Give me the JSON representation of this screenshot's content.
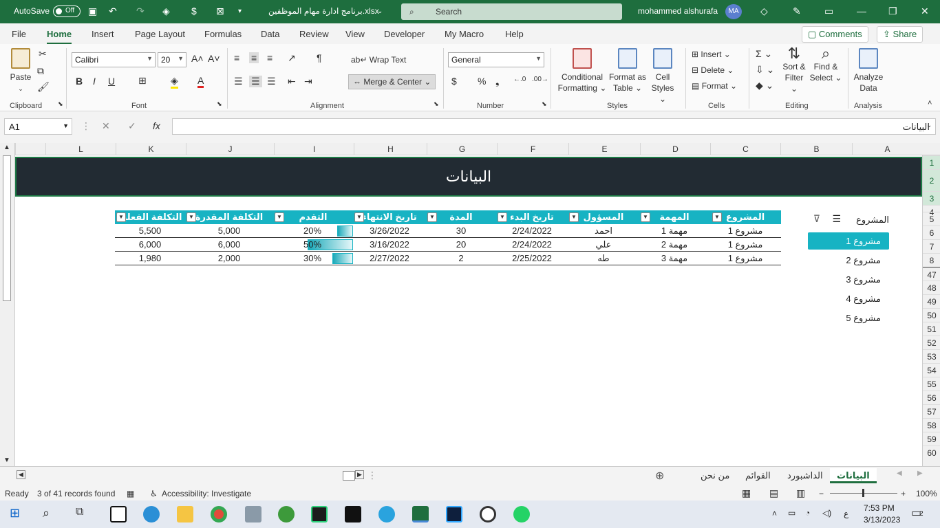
{
  "titlebar": {
    "autosave_label": "AutoSave",
    "autosave_state": "Off",
    "filename": "برنامج ادارة مهام الموظفين.xlsx",
    "search_placeholder": "Search",
    "user_name": "mohammed alshurafa",
    "user_initials": "MA"
  },
  "menu": {
    "items": [
      "File",
      "Home",
      "Insert",
      "Page Layout",
      "Formulas",
      "Data",
      "Review",
      "View",
      "Developer",
      "My Macro",
      "Help"
    ],
    "comments_label": "Comments",
    "share_label": "Share"
  },
  "ribbon": {
    "clipboard": {
      "paste": "Paste",
      "group": "Clipboard"
    },
    "font": {
      "name": "Calibri",
      "size": "20",
      "bold": "B",
      "italic": "I",
      "underline": "U",
      "group": "Font"
    },
    "alignment": {
      "wrap_text": "Wrap Text",
      "merge_center": "Merge & Center",
      "group": "Alignment"
    },
    "number": {
      "format": "General",
      "group": "Number"
    },
    "styles": {
      "conditional_1": "Conditional",
      "conditional_2": "Formatting",
      "format_table_1": "Format as",
      "format_table_2": "Table",
      "cell_styles_1": "Cell",
      "cell_styles_2": "Styles",
      "group": "Styles"
    },
    "cells": {
      "insert": "Insert",
      "delete": "Delete",
      "format": "Format",
      "group": "Cells"
    },
    "editing": {
      "sort_1": "Sort &",
      "sort_2": "Filter",
      "find_1": "Find &",
      "find_2": "Select",
      "group": "Editing"
    },
    "analysis": {
      "analyze_1": "Analyze",
      "analyze_2": "Data",
      "group": "Analysis"
    }
  },
  "formula_bar": {
    "name_box": "A1",
    "fx": "fx",
    "value": "البيانات"
  },
  "columns": [
    "L",
    "K",
    "J",
    "I",
    "H",
    "G",
    "F",
    "E",
    "D",
    "C",
    "B",
    "A"
  ],
  "rows": [
    "1",
    "2",
    "3",
    "4",
    "5",
    "6",
    "7",
    "8",
    "47",
    "48",
    "49",
    "50",
    "51",
    "52",
    "53",
    "54",
    "55",
    "56",
    "57",
    "58",
    "59",
    "60"
  ],
  "banner_title": "البيانات",
  "table": {
    "headers": [
      "المشروع",
      "المهمة",
      "المسؤول",
      "تاريخ البدء",
      "المدة",
      "تاريخ الانتهاء",
      "التقدم",
      "التكلفة المقدرة",
      "التكلفة الفعلية"
    ],
    "rows": [
      {
        "project": "مشروع 1",
        "task": "مهمة 1",
        "owner": "احمد",
        "start": "2/24/2022",
        "duration": "30",
        "end": "3/26/2022",
        "progress": "20%",
        "progress_value": 0.2,
        "estimated": "5,000",
        "actual": "5,500"
      },
      {
        "project": "مشروع 1",
        "task": "مهمة 2",
        "owner": "علي",
        "start": "2/24/2022",
        "duration": "20",
        "end": "3/16/2022",
        "progress": "50%",
        "progress_value": 0.5,
        "estimated": "6,000",
        "actual": "6,000"
      },
      {
        "project": "مشروع 1",
        "task": "مهمة 3",
        "owner": "طه",
        "start": "2/25/2022",
        "duration": "2",
        "end": "2/27/2022",
        "progress": "30%",
        "progress_value": 0.3,
        "estimated": "2,000",
        "actual": "1,980"
      }
    ]
  },
  "slicer": {
    "title": "المشروع",
    "items": [
      "مشروع 1",
      "مشروع 2",
      "مشروع 3",
      "مشروع 4",
      "مشروع 5"
    ],
    "selected": "مشروع 1"
  },
  "sheet_tabs": [
    "البيانات",
    "الداشبورد",
    "القوائم",
    "من نحن"
  ],
  "status": {
    "ready": "Ready",
    "records": "3 of 41 records found",
    "accessibility": "Accessibility: Investigate",
    "zoom": "100%"
  },
  "taskbar": {
    "time": "7:53 PM",
    "date": "3/13/2023",
    "lang": "ع",
    "notifications": "2"
  },
  "colors": {
    "excel_green": "#1e6e3e",
    "table_header": "#17b3c3",
    "banner_bg": "#222b33"
  }
}
